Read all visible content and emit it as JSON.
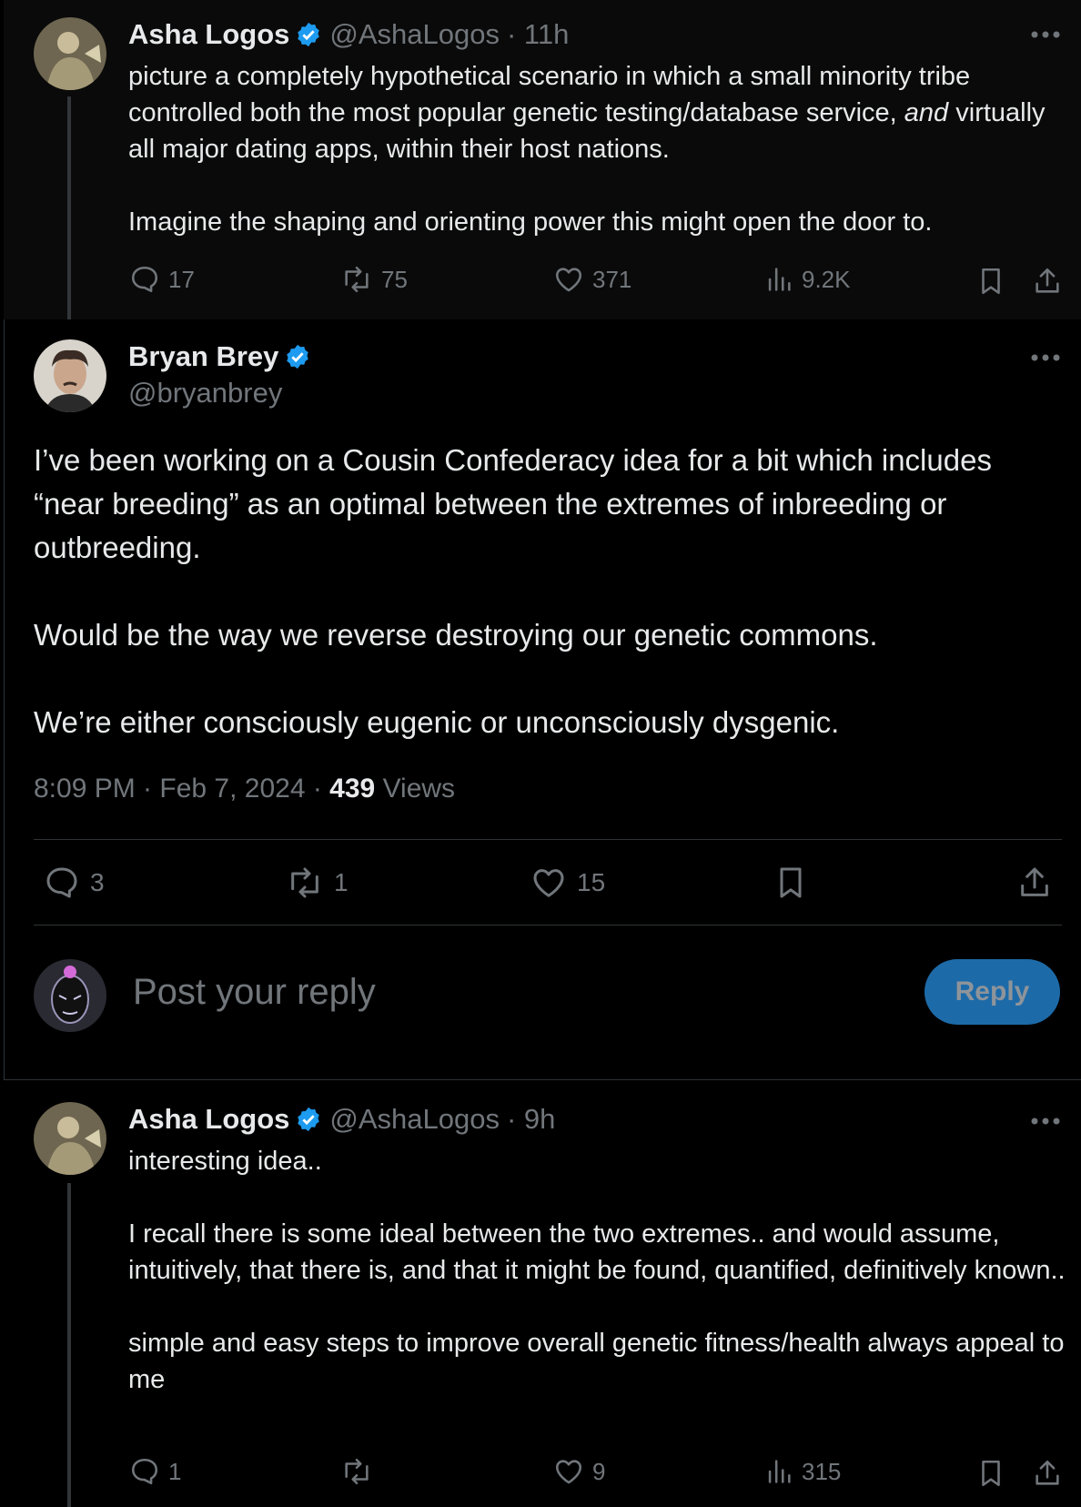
{
  "tweet_parent": {
    "name": "Asha Logos",
    "handle": "@AshaLogos",
    "time": "· 11h",
    "text_before_italic": "picture a completely hypothetical scenario in which a small minority tribe controlled both the most popular genetic testing/database service, ",
    "text_italic": "and",
    "text_after_italic": " virtually all major dating apps, within their host nations.",
    "text_para2": "Imagine the shaping and orienting power this might open the door to.",
    "replies": "17",
    "reposts": "75",
    "likes": "371",
    "views": "9.2K"
  },
  "tweet_main": {
    "name": "Bryan Brey",
    "handle": "@bryanbrey",
    "para1": "I’ve been working on a Cousin Confederacy idea for a bit which includes “near breeding” as an optimal between the extremes of inbreeding or outbreeding.",
    "para2": "Would be the way we reverse destroying our genetic commons.",
    "para3": "We’re either consciously eugenic or unconsciously dysgenic.",
    "time": "8:09 PM · Feb 7, 2024 · ",
    "views_count": "439",
    "views_label": " Views",
    "replies": "3",
    "reposts": "1",
    "likes": "15"
  },
  "composer": {
    "placeholder": "Post your reply",
    "button": "Reply"
  },
  "tweet_reply": {
    "name": "Asha Logos",
    "handle": "@AshaLogos",
    "time": "· 9h",
    "para1": "interesting idea..",
    "para2": "I recall there is some ideal between the two extremes.. and would assume, intuitively, that there is, and that it might be found, quantified, definitively known..",
    "para3": "simple and easy steps to improve overall genetic fitness/health always appeal to me",
    "replies": "1",
    "reposts": "",
    "likes": "9",
    "views": "315"
  },
  "colors": {
    "verified": "#1d9bf0",
    "reply_button": "#1d6aa8",
    "muted": "#71767b"
  }
}
